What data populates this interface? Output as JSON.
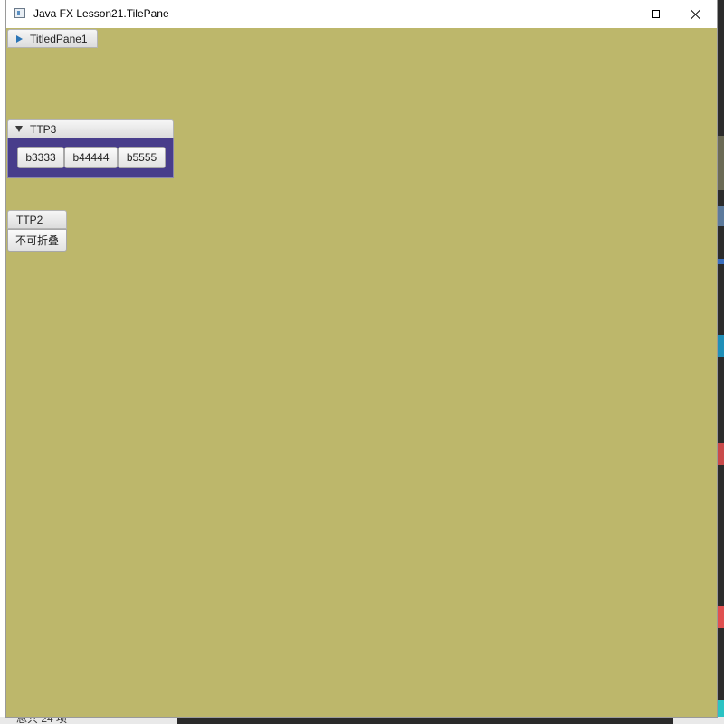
{
  "window": {
    "title": "Java FX Lesson21.TilePane"
  },
  "content": {
    "background": "#bdb76b",
    "titled_panes": [
      {
        "label": "TitledPane1",
        "expanded": false
      },
      {
        "label": "TTP3",
        "expanded": true,
        "body_color": "#483d8b",
        "buttons": [
          "b3333",
          "b44444",
          "b5555"
        ]
      },
      {
        "label": "TTP2",
        "collapsible": false,
        "button": "不可折叠"
      }
    ]
  },
  "desktop": {
    "taskbar_text": "总共 24 项"
  }
}
